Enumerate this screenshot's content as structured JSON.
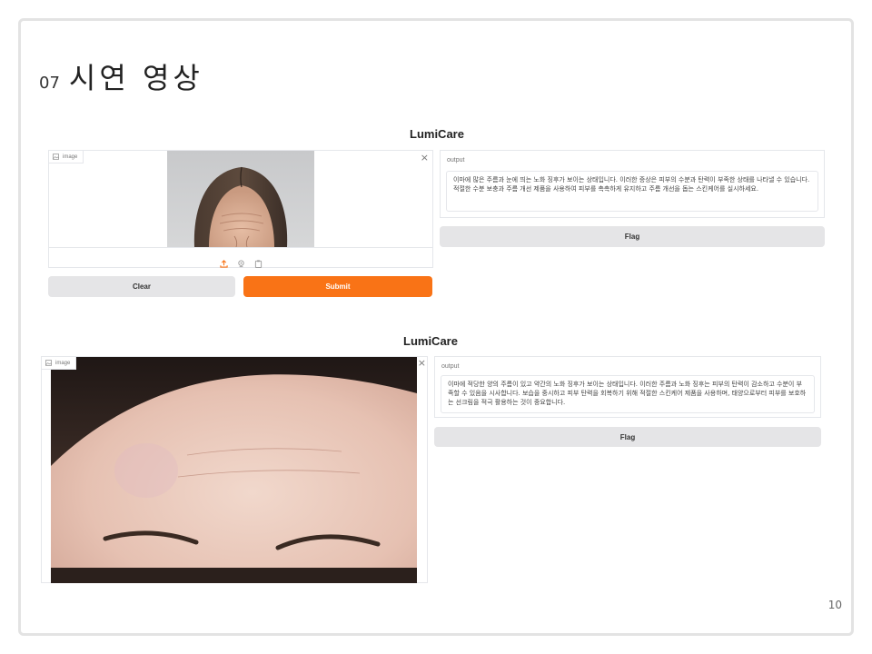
{
  "slide": {
    "number": "07",
    "title": "시연 영상",
    "page": "10"
  },
  "demo1": {
    "app_title": "LumiCare",
    "image_label": "image",
    "output_label": "output",
    "output_text": "이마에 많은 주름과 눈에 띄는 노화 징후가 보이는 상태입니다. 이러한 증상은 피부의 수분과 탄력이 부족한 상태를 나타낼 수 있습니다. 적절한 수분 보충과 주름 개선 제품을 사용하여 피부를 촉촉하게 유지하고 주름 개선을 돕는 스킨케어를 실시하세요.",
    "clear_label": "Clear",
    "submit_label": "Submit",
    "flag_label": "Flag",
    "close_glyph": "×"
  },
  "demo2": {
    "app_title": "LumiCare",
    "image_label": "image",
    "output_label": "output",
    "output_text": "이마에 적당한 양의 주름이 있고 약간의 노화 징후가 보이는 상태입니다. 이러한 주름과 노화 징후는 피부의 탄력이 감소하고 수분이 부족할 수 있음을 시사합니다. 보습을 중시하고 피부 탄력을 회복하기 위해 적절한 스킨케어 제품을 사용하며, 태양으로부터 피부를 보호하는 선크림을 적극 활용하는 것이 중요합니다.",
    "flag_label": "Flag",
    "close_glyph": "×"
  },
  "colors": {
    "accent": "#f97316",
    "button_gray": "#e5e5e7"
  },
  "icons": [
    "image-icon",
    "upload-icon",
    "webcam-icon",
    "clipboard-icon",
    "close-icon"
  ]
}
